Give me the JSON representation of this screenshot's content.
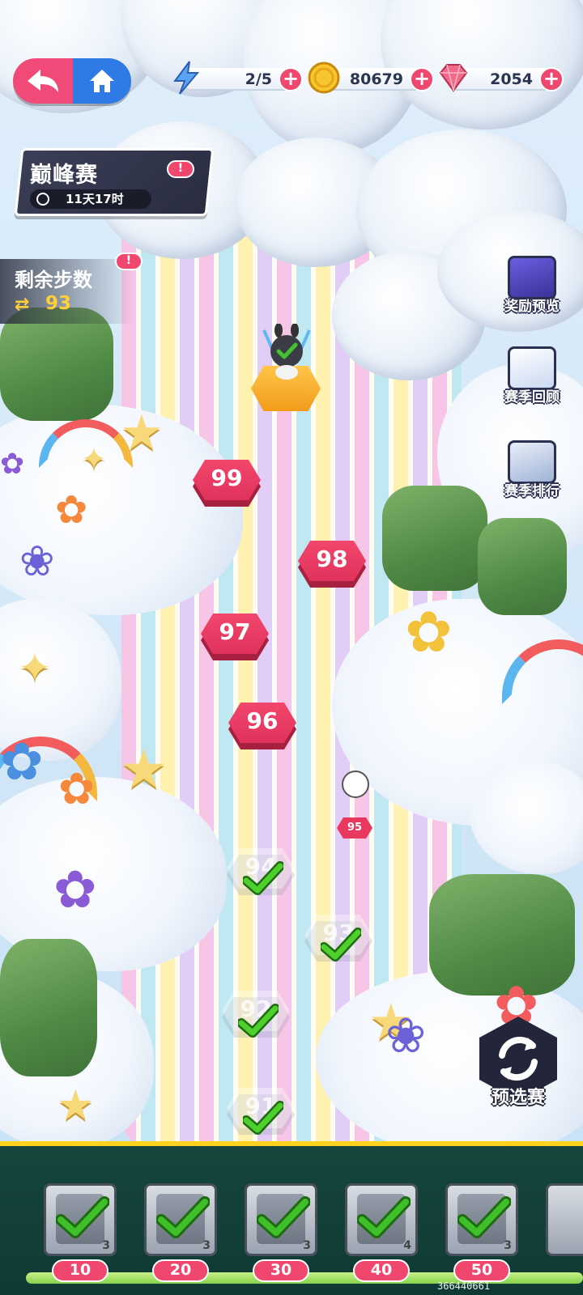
{
  "resources": {
    "energy": {
      "value": "2/5",
      "icon": "lightning-icon"
    },
    "coins": {
      "value": "80679",
      "icon": "coin-icon"
    },
    "gems": {
      "value": "2054",
      "icon": "gem-icon"
    },
    "plus": "+"
  },
  "event": {
    "title": "巅峰赛",
    "timer": "11天17时",
    "badge": "!"
  },
  "steps": {
    "label": "剩余步数",
    "value": "93",
    "badge": "!"
  },
  "side_buttons": {
    "reward_preview": "奖励预览",
    "season_review": "赛季回顾",
    "season_ranking": "赛季排行"
  },
  "levels": {
    "n99": "99",
    "n98": "98",
    "n97": "97",
    "n96": "96",
    "n95": "95",
    "n94": "94",
    "n93": "93",
    "n92": "92",
    "n91": "91"
  },
  "qualifier": {
    "label": "预选赛"
  },
  "rewards": [
    {
      "milestone": "10",
      "count": "3"
    },
    {
      "milestone": "20",
      "count": "3"
    },
    {
      "milestone": "30",
      "count": "3"
    },
    {
      "milestone": "40",
      "count": "4"
    },
    {
      "milestone": "50",
      "count": "3"
    }
  ],
  "user_id": "366440661",
  "colors": {
    "accent_pink": "#f0476f",
    "home_blue": "#2f7ae5",
    "check_green": "#3fbf2a",
    "bar_green": "#16463d"
  }
}
